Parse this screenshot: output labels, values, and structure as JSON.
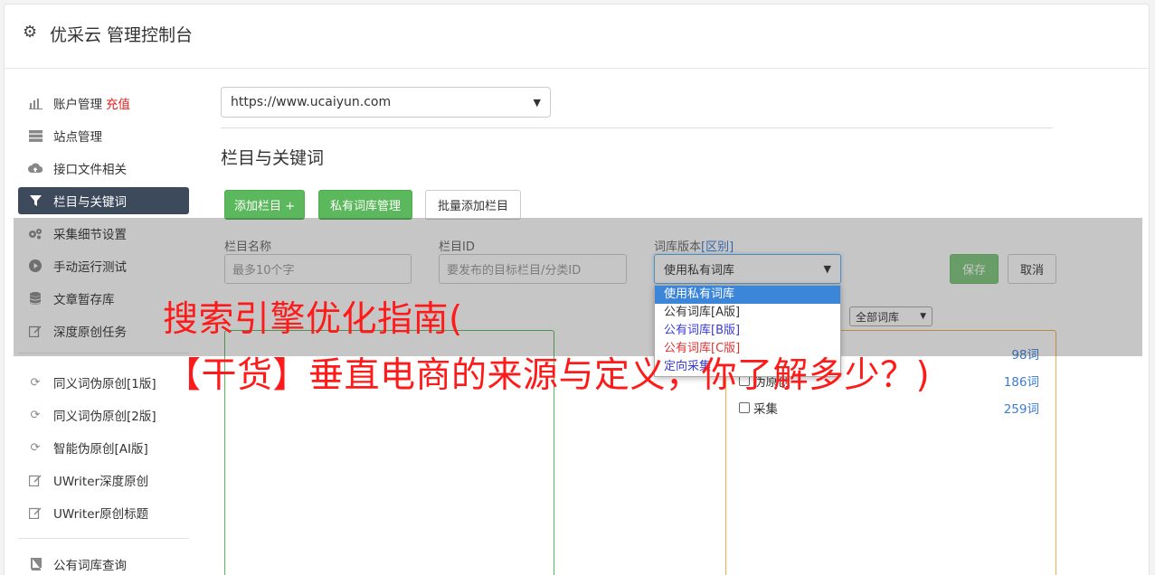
{
  "header": {
    "title": "优采云 管理控制台"
  },
  "sidebar": {
    "items": [
      {
        "label": "账户管理",
        "icon": "bar-chart-icon"
      },
      {
        "label": "站点管理",
        "icon": "server-icon"
      },
      {
        "label": "接口文件相关",
        "icon": "cloud-upload-icon"
      },
      {
        "label": "栏目与关键词",
        "icon": "filter-icon",
        "active": true
      },
      {
        "label": "采集细节设置",
        "icon": "gears-icon"
      },
      {
        "label": "手动运行测试",
        "icon": "play-icon"
      },
      {
        "label": "文章暂存库",
        "icon": "database-icon"
      },
      {
        "label": "深度原创任务",
        "icon": "edit-icon"
      },
      {
        "label": "同义词伪原创[1版]",
        "icon": "refresh-icon"
      },
      {
        "label": "同义词伪原创[2版]",
        "icon": "refresh-icon"
      },
      {
        "label": "智能伪原创[AI版]",
        "icon": "refresh-icon"
      },
      {
        "label": "UWriter深度原创",
        "icon": "edit-icon"
      },
      {
        "label": "UWriter原创标题",
        "icon": "edit-icon"
      },
      {
        "label": "公有词库查询",
        "icon": "book-icon"
      }
    ],
    "recharge_label": "充值"
  },
  "main": {
    "site_select_value": "https://www.ucaiyun.com",
    "section_title": "栏目与关键词",
    "buttons": {
      "add_column": "添加栏目 +",
      "private_lib": "私有词库管理",
      "batch_add": "批量添加栏目",
      "save": "保存",
      "cancel": "取消"
    },
    "form": {
      "name_label": "栏目名称",
      "name_placeholder": "最多10个字",
      "id_label": "栏目ID",
      "id_placeholder": "要发布的目标栏目/分类ID",
      "version_label": "词库版本",
      "version_label_link": "[区别]",
      "version_value": "使用私有词库",
      "version_options": [
        "使用私有词库",
        "公有词库[A版]",
        "公有词库[B版]",
        "公有词库[C版]",
        "定向采集"
      ]
    },
    "lib_filter": "全部词库",
    "libraries": [
      {
        "name": "",
        "count": "98词"
      },
      {
        "name": "伪原创",
        "count": "186词"
      },
      {
        "name": "采集",
        "count": "259词"
      }
    ]
  },
  "watermark": {
    "line1": "搜索引擎优化指南(",
    "line2": "【干货】垂直电商的来源与定义，你了解多少？)"
  },
  "colors": {
    "green": "#5cb85c",
    "active_nav": "#3d4a5c",
    "recharge": "#e02020",
    "watermark": "#ff1a1a"
  }
}
